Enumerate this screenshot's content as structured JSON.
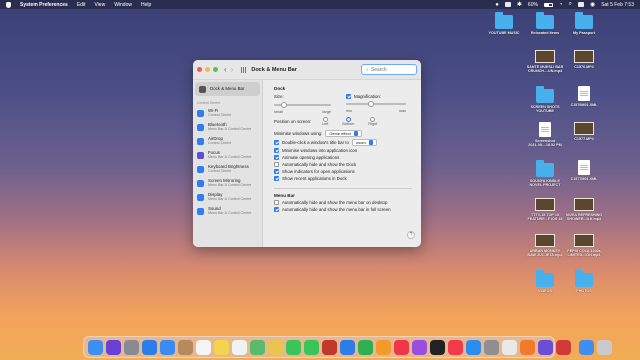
{
  "menubar": {
    "app_name": "System Preferences",
    "items": [
      "Edit",
      "View",
      "Window",
      "Help"
    ],
    "battery_percent": "60%",
    "date_time": "Sat 5 Feb  7:53",
    "battery_level": 0.6
  },
  "window": {
    "title": "Dock & Menu Bar",
    "search_placeholder": "Search",
    "sidebar": [
      {
        "label": "Dock & Menu Bar",
        "sub": "",
        "icon": "dock-icon",
        "color": "#555555",
        "selected": true
      },
      {
        "group": "Control Centre"
      },
      {
        "label": "Wi-Fi",
        "sub": "Control Centre",
        "icon": "wifi-icon",
        "color": "#2f7cf6"
      },
      {
        "label": "Bluetooth",
        "sub": "Menu Bar & Control Centre",
        "icon": "bluetooth-icon",
        "color": "#2f7cf6"
      },
      {
        "label": "AirDrop",
        "sub": "Control Centre",
        "icon": "airdrop-icon",
        "color": "#2f7cf6"
      },
      {
        "label": "Focus",
        "sub": "Menu Bar & Control Centre",
        "icon": "moon-icon",
        "color": "#5b4fd6"
      },
      {
        "label": "Keyboard Brightness",
        "sub": "Control Centre",
        "icon": "keyboard-icon",
        "color": "#2f7cf6"
      },
      {
        "label": "Screen Mirroring",
        "sub": "Menu Bar & Control Centre",
        "icon": "mirroring-icon",
        "color": "#2f7cf6"
      },
      {
        "label": "Display",
        "sub": "Menu Bar & Control Centre",
        "icon": "display-icon",
        "color": "#2f7cf6"
      },
      {
        "label": "Sound",
        "sub": "Menu Bar & Control Centre",
        "icon": "sound-icon",
        "color": "#2f7cf6"
      }
    ],
    "dock_section": "Dock",
    "size_label": "Size:",
    "size_min": "small",
    "size_max": "large",
    "size_value": 0.18,
    "magnification_label": "Magnification:",
    "mag_min": "min",
    "mag_max": "max",
    "mag_value": 0.42,
    "position_label": "Position on screen:",
    "positions": [
      "Left",
      "Bottom",
      "Right"
    ],
    "minimise_label": "Minimise windows using:",
    "minimise_value": "Genie effect",
    "double_click_label": "Double-click a window's title bar to",
    "double_click_value": "zoom",
    "checks": [
      {
        "label": "Minimise windows into application icon",
        "checked": true
      },
      {
        "label": "Animate opening applications",
        "checked": true
      },
      {
        "label": "Automatically hide and show the Dock",
        "checked": false
      },
      {
        "label": "Show indicators for open applications",
        "checked": true
      },
      {
        "label": "Show recent applications in Dock",
        "checked": true
      }
    ],
    "menubar_section": "Menu Bar",
    "menubar_checks": [
      {
        "label": "Automatically hide and show the menu bar on desktop",
        "checked": false
      },
      {
        "label": "Automatically hide and show the menu bar in full screen",
        "checked": true
      }
    ],
    "help_label": "?"
  },
  "desktop": [
    {
      "label": "YOUTUBE MUSIC",
      "kind": "folder"
    },
    {
      "label": "Relocated Items",
      "kind": "folder"
    },
    {
      "label": "My Passport",
      "kind": "folder"
    },
    {
      "label": "SANTE MUESLI BAR\nCRUNCH....UN.mp4",
      "kind": "thumb"
    },
    {
      "label": "C1576.MP4",
      "kind": "thumb"
    },
    {
      "label": "SCREEN SHOTS\nYOUTUBE",
      "kind": "folder"
    },
    {
      "label": "C1576M01.XML",
      "kind": "doc"
    },
    {
      "label": "Screenshot\n2021-08....18.52 PM",
      "kind": "doc"
    },
    {
      "label": "C1577.MP4",
      "kind": "thumb"
    },
    {
      "label": "SOUNYA KINDLE\nNOVEL PROJECT",
      "kind": "folder"
    },
    {
      "label": "C1577M01.XML",
      "kind": "doc"
    },
    {
      "label": "TTTV-15.TOP 15\nFEATURE...F IOS 15",
      "kind": "thumb"
    },
    {
      "label": "NIVEA REFRESHING\nSHOWER...ILK.mp4",
      "kind": "thumb"
    },
    {
      "label": "URBAN MONKEY\nBAW JUI...IETA.mp4",
      "kind": "thumb"
    },
    {
      "label": "PEPSI COLA 1940s\nLIMITED...ION.mp4",
      "kind": "thumb"
    },
    {
      "label": "VIDEOS",
      "kind": "folder"
    },
    {
      "label": "PHOTOS",
      "kind": "folder"
    }
  ],
  "dock": [
    {
      "name": "finder-icon",
      "color": "#3d8ff0"
    },
    {
      "name": "siri-icon",
      "color": "#6a3fd6"
    },
    {
      "name": "launchpad-icon",
      "color": "#8a8a92"
    },
    {
      "name": "safari-icon",
      "color": "#2b7de9"
    },
    {
      "name": "mail-icon",
      "color": "#3b8cf2"
    },
    {
      "name": "contacts-icon",
      "color": "#b58a5d"
    },
    {
      "name": "calendar-icon",
      "color": "#f5f5f5"
    },
    {
      "name": "notes-icon",
      "color": "#f6d34f"
    },
    {
      "name": "reminders-icon",
      "color": "#f2f2f2"
    },
    {
      "name": "maps-icon",
      "color": "#59b96c"
    },
    {
      "name": "photos-icon",
      "color": "#e9c44e"
    },
    {
      "name": "facetime-icon",
      "color": "#3bc45a"
    },
    {
      "name": "messages-icon",
      "color": "#3bc45a"
    },
    {
      "name": "photo-booth-icon",
      "color": "#c0392b"
    },
    {
      "name": "keynote-icon",
      "color": "#2b7de9"
    },
    {
      "name": "numbers-icon",
      "color": "#2fae52"
    },
    {
      "name": "pages-icon",
      "color": "#f39a2b"
    },
    {
      "name": "music-icon",
      "color": "#f2364a"
    },
    {
      "name": "podcasts-icon",
      "color": "#9a4ee0"
    },
    {
      "name": "tv-icon",
      "color": "#222222"
    },
    {
      "name": "news-icon",
      "color": "#f23b4a"
    },
    {
      "name": "app-store-icon",
      "color": "#2b8cf0"
    },
    {
      "name": "system-preferences-icon",
      "color": "#8e8e93"
    },
    {
      "name": "chrome-icon",
      "color": "#e9e9e9"
    },
    {
      "name": "firefox-icon",
      "color": "#f27b2b"
    },
    {
      "name": "imovie-icon",
      "color": "#6a4fd6"
    },
    {
      "name": "utility-icon",
      "color": "#d23a3a"
    },
    {
      "name": "sep",
      "color": ""
    },
    {
      "name": "downloads-icon",
      "color": "#3f8ef0"
    },
    {
      "name": "trash-icon",
      "color": "#c9c9cf"
    }
  ]
}
